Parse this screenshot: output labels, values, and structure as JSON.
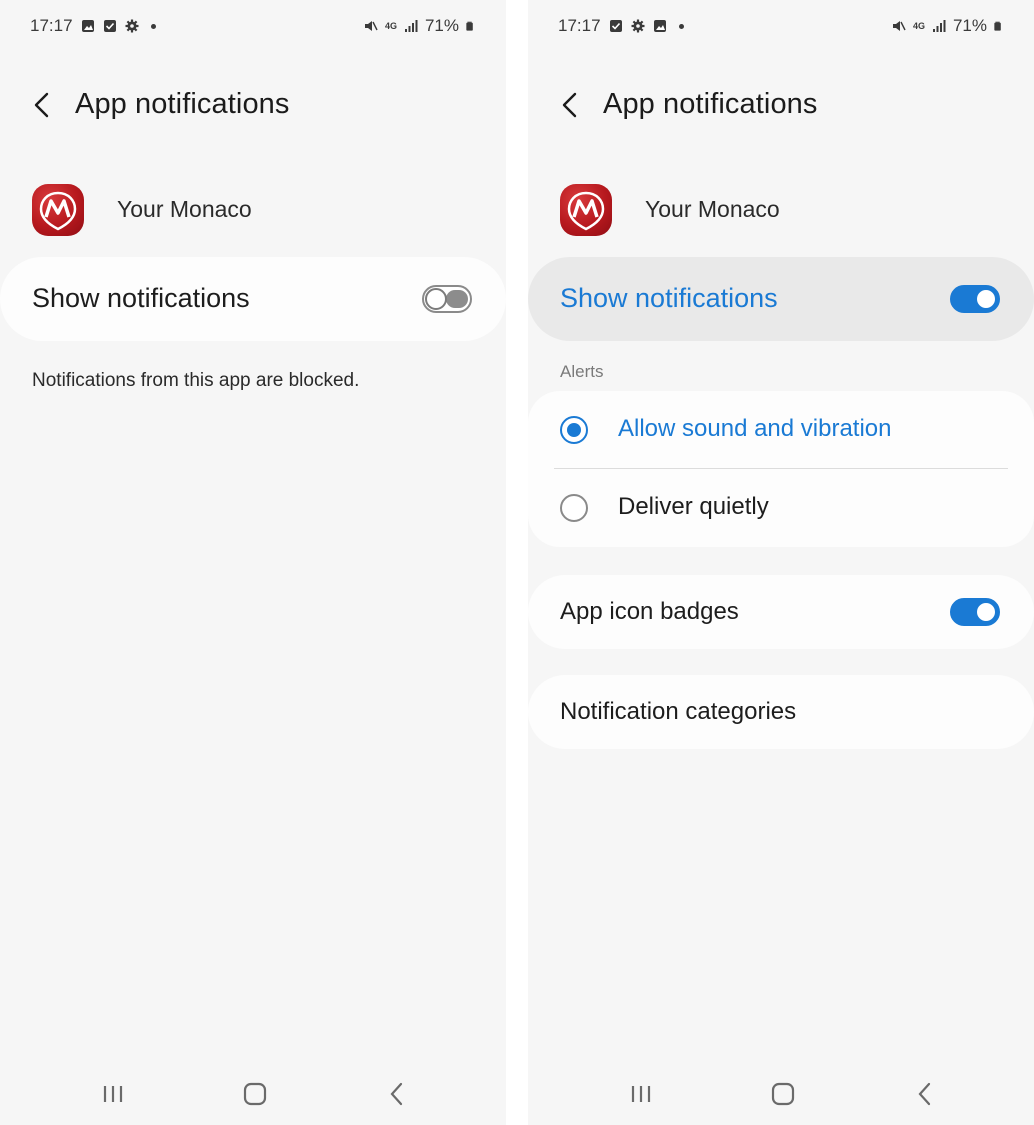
{
  "left_screen": {
    "status_bar": {
      "time": "17:17",
      "battery": "71%",
      "network": "4G"
    },
    "header": {
      "title": "App notifications"
    },
    "app": {
      "name": "Your Monaco",
      "icon_letter": "M"
    },
    "show_notifications": {
      "label": "Show notifications",
      "enabled": false
    },
    "blocked_message": "Notifications from this app are blocked."
  },
  "right_screen": {
    "status_bar": {
      "time": "17:17",
      "battery": "71%",
      "network": "4G"
    },
    "header": {
      "title": "App notifications"
    },
    "app": {
      "name": "Your Monaco",
      "icon_letter": "M"
    },
    "show_notifications": {
      "label": "Show notifications",
      "enabled": true
    },
    "alerts": {
      "section_label": "Alerts",
      "options": [
        {
          "label": "Allow sound and vibration",
          "selected": true
        },
        {
          "label": "Deliver quietly",
          "selected": false
        }
      ]
    },
    "app_icon_badges": {
      "label": "App icon badges",
      "enabled": true
    },
    "notification_categories": {
      "label": "Notification categories"
    }
  },
  "colors": {
    "accent": "#1a7ad4",
    "background": "#f6f6f6",
    "card": "#fdfdfd",
    "brand": "#b7191e"
  }
}
